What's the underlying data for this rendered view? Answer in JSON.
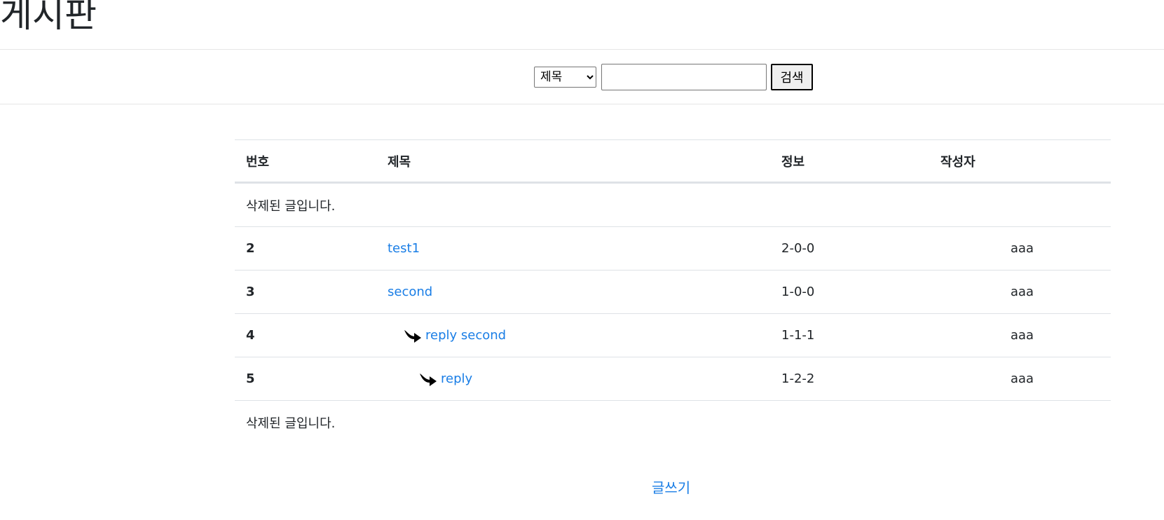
{
  "page": {
    "title": "게시판"
  },
  "search": {
    "selected_option": "제목",
    "input_value": "",
    "button_label": "검색"
  },
  "table": {
    "headers": {
      "num": "번호",
      "subject": "제목",
      "info": "정보",
      "writer": "작성자"
    },
    "deleted_message": "삭제된 글입니다.",
    "rows": [
      {
        "num": "2",
        "subject": "test1",
        "info": "2-0-0",
        "writer": "aaa"
      },
      {
        "num": "3",
        "subject": "second",
        "info": "1-0-0",
        "writer": "aaa"
      },
      {
        "num": "4",
        "subject": "reply second",
        "info": "1-1-1",
        "writer": "aaa"
      },
      {
        "num": "5",
        "subject": "reply",
        "info": "1-2-2",
        "writer": "aaa"
      }
    ]
  },
  "footer": {
    "write_label": "글쓰기"
  },
  "colors": {
    "link": "#1a7ee6",
    "text": "#212529",
    "border": "#dee2e6"
  },
  "icons": {
    "reply": "reply-arrow-icon"
  }
}
